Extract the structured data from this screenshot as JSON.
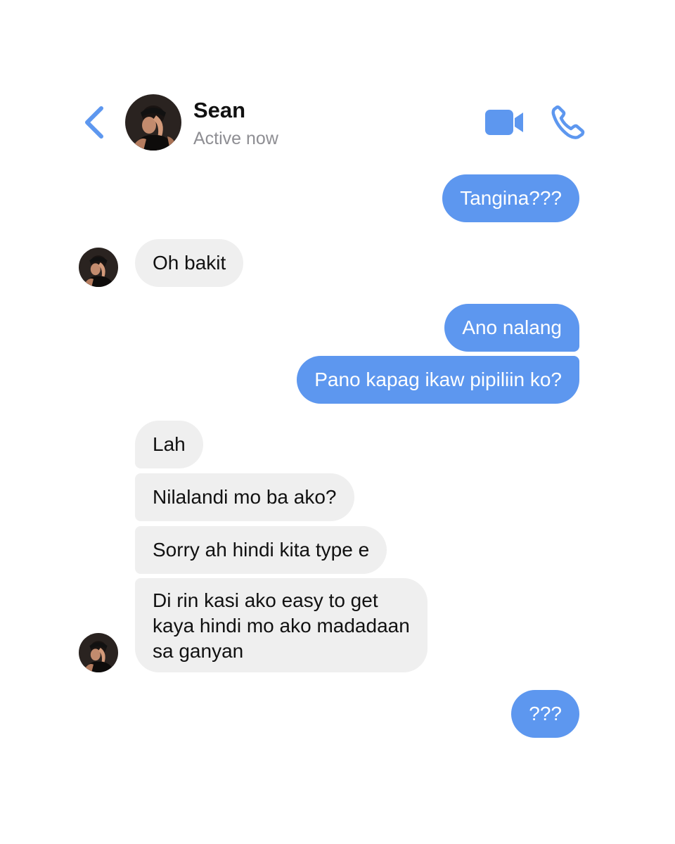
{
  "header": {
    "contact_name": "Sean",
    "status": "Active now",
    "back_icon": "chevron-left-icon",
    "video_icon": "video-camera-icon",
    "call_icon": "phone-icon",
    "accent_color": "#5d97ef"
  },
  "messages": [
    {
      "from": "me",
      "text": "Tangina???"
    },
    {
      "from": "sean",
      "text": "Oh bakit"
    },
    {
      "from": "me",
      "text": "Ano nalang"
    },
    {
      "from": "me",
      "text": "Pano kapag ikaw pipiliin ko?"
    },
    {
      "from": "sean",
      "text": "Lah"
    },
    {
      "from": "sean",
      "text": "Nilalandi mo ba ako?"
    },
    {
      "from": "sean",
      "text": "Sorry ah hindi kita type e"
    },
    {
      "from": "sean",
      "lines": [
        "Di rin kasi ako easy to get",
        "kaya hindi mo ako madadaan",
        "sa ganyan"
      ]
    },
    {
      "from": "me",
      "text": "???"
    }
  ],
  "colors": {
    "sent_bubble": "#5d97ef",
    "received_bubble": "#efefef",
    "status_text": "#8e8e93"
  }
}
